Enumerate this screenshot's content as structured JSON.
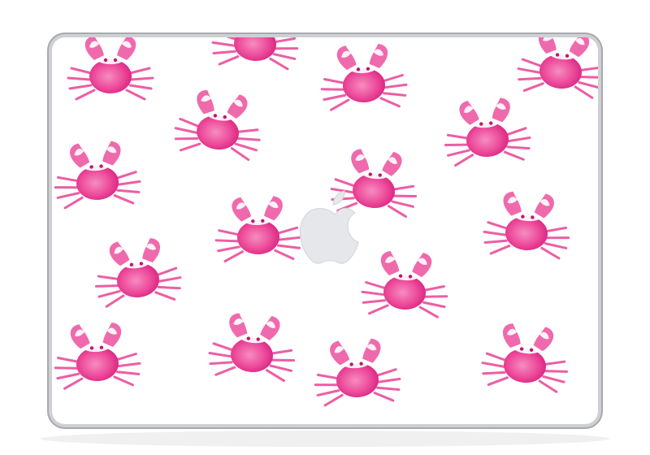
{
  "image": {
    "subject": "laptop-lid-skin",
    "pattern": "watercolor-pink-crabs",
    "logo": "apple-logo-cutout",
    "colors": {
      "background": "#ffffff",
      "skin": "#ffffff",
      "lid_edge": "#b9babd",
      "lid_edge_dark": "#8e8f93",
      "crab_light": "#f58dc0",
      "crab_mid": "#ee4f9d",
      "crab_dark": "#d81f7e",
      "claw_highlight": "#ffffff",
      "logo": "#e6e7ea"
    }
  }
}
